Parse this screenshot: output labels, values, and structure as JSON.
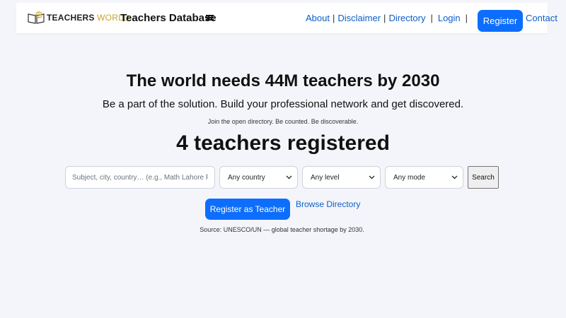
{
  "navbar": {
    "logo": {
      "word1": "TEACHERS",
      "word2": "WORLD"
    },
    "brand_title": "Teachers Database",
    "links": {
      "about": "About",
      "disclaimer": "Disclaimer",
      "directory": "Directory",
      "login": "Login",
      "register": "Register",
      "contact": "Contact"
    },
    "separator": "|"
  },
  "hero": {
    "headline": "The world needs 44M teachers by 2030",
    "subheadline": "Be a part of the solution. Build your professional network and get discovered.",
    "note": "Join the open directory. Be counted. Be discoverable.",
    "count_text": "4 teachers registered"
  },
  "search": {
    "placeholder": "Subject, city, country… (e.g., Math Lahore P",
    "country_select": "Any country",
    "level_select": "Any level",
    "mode_select": "Any mode",
    "button_label": "Search"
  },
  "cta": {
    "register_button": "Register as Teacher",
    "browse_link": "Browse Directory"
  },
  "footer_note": "Source: UNESCO/UN — global teacher shortage by 2030.",
  "colors": {
    "accent": "#0d6efd",
    "link": "#0d5ec7",
    "logo_gold": "#c9a227",
    "background": "#f4f5fa"
  },
  "icons": {
    "logo": "open-book-globe-icon",
    "menu": "hamburger-menu-icon",
    "select": "chevron-down-icon"
  }
}
